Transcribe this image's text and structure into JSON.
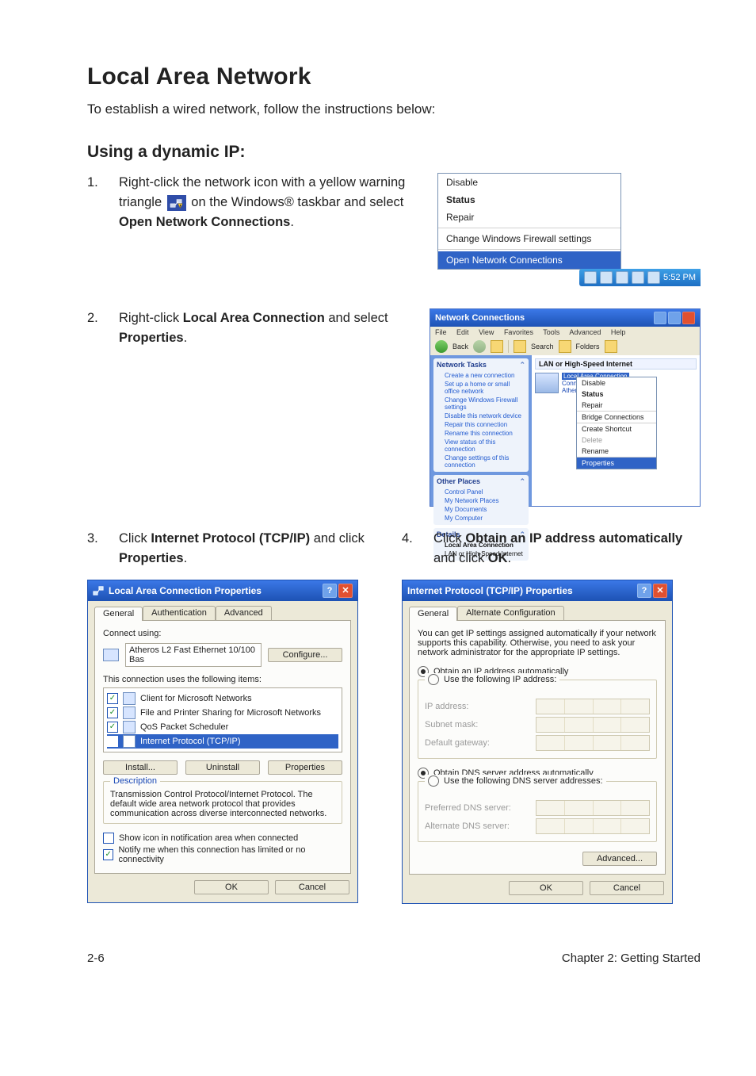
{
  "title": "Local Area Network",
  "intro": "To establish a wired network, follow the instructions below:",
  "subtitle": "Using a dynamic IP:",
  "steps": {
    "s1_num": "1.",
    "s1_a": "Right-click the network icon with a yellow warning triangle ",
    "s1_b": " on the Windows® taskbar and select ",
    "s1_c": "Open Network Connections",
    "s1_d": ".",
    "s2_num": "2.",
    "s2_a": "Right-click ",
    "s2_b": "Local Area Connection",
    "s2_c": " and select ",
    "s2_d": "Properties",
    "s2_e": ".",
    "s3_num": "3.",
    "s3_a": "Click ",
    "s3_b": "Internet Protocol (TCP/IP)",
    "s3_c": " and click ",
    "s3_d": "Properties",
    "s3_e": ".",
    "s4_num": "4.",
    "s4_a": "Click ",
    "s4_b": "Obtain an IP address automatically",
    "s4_c": " and click ",
    "s4_d": "OK",
    "s4_e": "."
  },
  "fig1": {
    "items": {
      "disable": "Disable",
      "status": "Status",
      "repair": "Repair",
      "firewall": "Change Windows Firewall settings",
      "open": "Open Network Connections"
    },
    "clock": "5:52 PM"
  },
  "fig2": {
    "title": "Network Connections",
    "menu": {
      "file": "File",
      "edit": "Edit",
      "view": "View",
      "fav": "Favorites",
      "tools": "Tools",
      "adv": "Advanced",
      "help": "Help"
    },
    "toolbar": {
      "back": "Back",
      "search": "Search",
      "folders": "Folders"
    },
    "panels": {
      "p1_head": "Network Tasks",
      "p1": [
        "Create a new connection",
        "Set up a home or small office network",
        "Change Windows Firewall settings",
        "Disable this network device",
        "Repair this connection",
        "Rename this connection",
        "View status of this connection",
        "Change settings of this connection"
      ],
      "p2_head": "Other Places",
      "p2": [
        "Control Panel",
        "My Network Places",
        "My Documents",
        "My Computer"
      ],
      "p3_head": "Details",
      "p3": [
        "Local Area Connection",
        "LAN or High-Speed Internet"
      ]
    },
    "group": "LAN or High-Speed Internet",
    "conn_line1": "Local Area Connection",
    "conn_line2": "Connected, Fir...",
    "conn_line3": "Atheros L2 Fa...",
    "ctx": {
      "disable": "Disable",
      "status": "Status",
      "repair": "Repair",
      "bridge": "Bridge Connections",
      "shortcut": "Create Shortcut",
      "delete": "Delete",
      "rename": "Rename",
      "properties": "Properties"
    }
  },
  "dlg3": {
    "title": "Local Area Connection Properties",
    "tabs": {
      "general": "General",
      "auth": "Authentication",
      "adv": "Advanced"
    },
    "connect_using": "Connect using:",
    "adapter": "Atheros L2 Fast Ethernet 10/100 Bas",
    "configure": "Configure...",
    "uses": "This connection uses the following items:",
    "items": {
      "i1": "Client for Microsoft Networks",
      "i2": "File and Printer Sharing for Microsoft Networks",
      "i3": "QoS Packet Scheduler",
      "i4": "Internet Protocol (TCP/IP)"
    },
    "install": "Install...",
    "uninstall": "Uninstall",
    "properties": "Properties",
    "desc_head": "Description",
    "desc_body": "Transmission Control Protocol/Internet Protocol. The default wide area network protocol that provides communication across diverse interconnected networks.",
    "showicon": "Show icon in notification area when connected",
    "notify": "Notify me when this connection has limited or no connectivity",
    "ok": "OK",
    "cancel": "Cancel"
  },
  "dlg4": {
    "title": "Internet Protocol (TCP/IP) Properties",
    "tabs": {
      "general": "General",
      "alt": "Alternate Configuration"
    },
    "blurb": "You can get IP settings assigned automatically if your network supports this capability. Otherwise, you need to ask your network administrator for the appropriate IP settings.",
    "r_auto": "Obtain an IP address automatically",
    "r_manual": "Use the following IP address:",
    "ip": "IP address:",
    "subnet": "Subnet mask:",
    "gateway": "Default gateway:",
    "dns_auto": "Obtain DNS server address automatically",
    "dns_manual": "Use the following DNS server addresses:",
    "pdns": "Preferred DNS server:",
    "adns": "Alternate DNS server:",
    "advanced": "Advanced...",
    "ok": "OK",
    "cancel": "Cancel"
  },
  "footer": {
    "page": "2-6",
    "chapter": "Chapter 2: Getting Started"
  }
}
